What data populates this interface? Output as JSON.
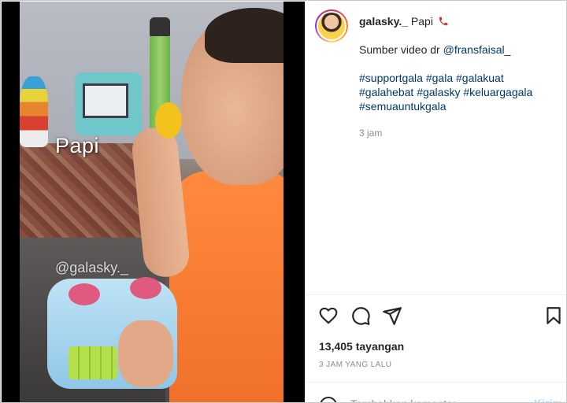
{
  "video": {
    "overlay_caption": "Papi",
    "watermark": "@galasky._"
  },
  "post": {
    "username": "galasky._",
    "caption_first": "Papi",
    "caption_emoji_icon": "telephone-receiver-icon",
    "caption_source_prefix": "Sumber video dr",
    "caption_source_mention": "@fransfaisal_",
    "hashtag_lines": [
      [
        "#supportgala",
        "#gala",
        "#galakuat"
      ],
      [
        "#galahebat",
        "#galasky",
        "#keluargagala"
      ],
      [
        "#semuauntukgala"
      ]
    ],
    "caption_time": "3 jam"
  },
  "actions": {
    "like_icon": "heart-icon",
    "comment_icon": "comment-icon",
    "share_icon": "paper-plane-icon",
    "save_icon": "bookmark-icon"
  },
  "stats": {
    "views": "13,405 tayangan",
    "posted_ago": "3 JAM YANG LALU"
  },
  "comment": {
    "placeholder": "Tambahkan komentar...",
    "post_label": "Kirim"
  },
  "colors": {
    "link": "#00376b",
    "muted": "#8e8e8e",
    "post_button_disabled": "#b2dffc",
    "phone_emoji": "#d1363b"
  }
}
